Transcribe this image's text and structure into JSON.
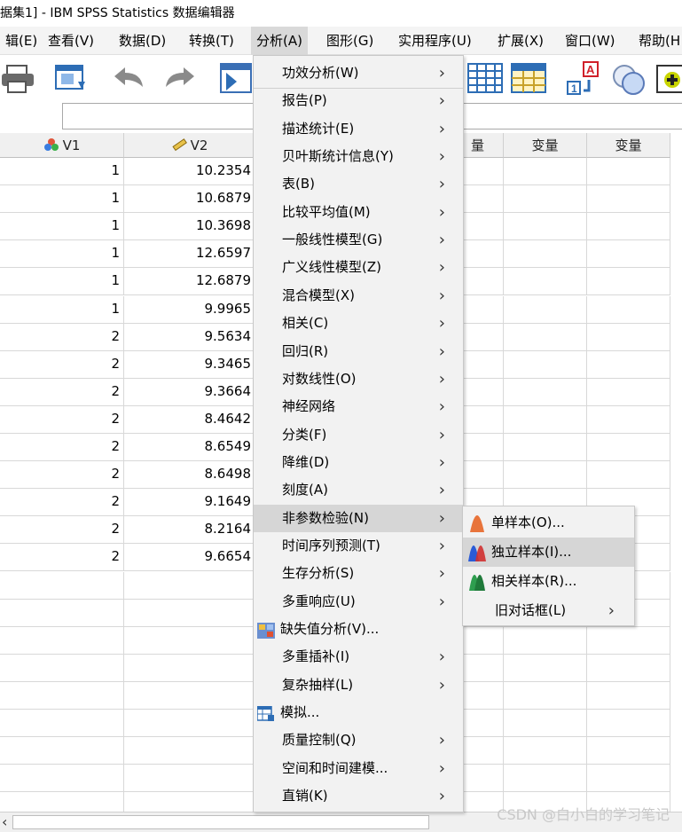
{
  "window": {
    "title": "据集1] - IBM SPSS Statistics 数据编辑器"
  },
  "menubar": [
    {
      "label": "辑(E)",
      "active": false
    },
    {
      "label": "查看(V)",
      "active": false
    },
    {
      "label": "数据(D)",
      "active": false
    },
    {
      "label": "转换(T)",
      "active": false
    },
    {
      "label": "分析(A)",
      "active": true
    },
    {
      "label": "图形(G)",
      "active": false
    },
    {
      "label": "实用程序(U)",
      "active": false
    },
    {
      "label": "扩展(X)",
      "active": false
    },
    {
      "label": "窗口(W)",
      "active": false
    },
    {
      "label": "帮助(H",
      "active": false
    }
  ],
  "toolbar": {
    "icons": [
      "print-icon",
      "recall-dialog-icon",
      "undo-icon",
      "redo-icon",
      "goto-case-icon",
      "goto-variable-icon",
      "variables-icon",
      "value-labels-icon",
      "use-sets-icon",
      "add-icon"
    ]
  },
  "grid": {
    "columns": [
      "V1",
      "V2",
      "变量",
      "变量",
      "变量"
    ],
    "rows": [
      [
        "1",
        "10.2354"
      ],
      [
        "1",
        "10.6879"
      ],
      [
        "1",
        "10.3698"
      ],
      [
        "1",
        "12.6597"
      ],
      [
        "1",
        "12.6879"
      ],
      [
        "1",
        "9.9965"
      ],
      [
        "2",
        "9.5634"
      ],
      [
        "2",
        "9.3465"
      ],
      [
        "2",
        "9.3664"
      ],
      [
        "2",
        "8.4642"
      ],
      [
        "2",
        "8.6549"
      ],
      [
        "2",
        "8.6498"
      ],
      [
        "2",
        "9.1649"
      ],
      [
        "2",
        "8.2164"
      ],
      [
        "2",
        "9.6654"
      ]
    ],
    "partial_col_header": "量"
  },
  "analyze_menu": {
    "items": [
      {
        "label": "功效分析(W)",
        "arrow": true
      },
      {
        "label": "报告(P)",
        "arrow": true
      },
      {
        "label": "描述统计(E)",
        "arrow": true
      },
      {
        "label": "贝叶斯统计信息(Y)",
        "arrow": true
      },
      {
        "label": "表(B)",
        "arrow": true
      },
      {
        "label": "比较平均值(M)",
        "arrow": true
      },
      {
        "label": "一般线性模型(G)",
        "arrow": true
      },
      {
        "label": "广义线性模型(Z)",
        "arrow": true
      },
      {
        "label": "混合模型(X)",
        "arrow": true
      },
      {
        "label": "相关(C)",
        "arrow": true
      },
      {
        "label": "回归(R)",
        "arrow": true
      },
      {
        "label": "对数线性(O)",
        "arrow": true
      },
      {
        "label": "神经网络",
        "arrow": true
      },
      {
        "label": "分类(F)",
        "arrow": true
      },
      {
        "label": "降维(D)",
        "arrow": true
      },
      {
        "label": "刻度(A)",
        "arrow": true
      },
      {
        "label": "非参数检验(N)",
        "arrow": true,
        "highlighted": true
      },
      {
        "label": "时间序列预测(T)",
        "arrow": true
      },
      {
        "label": "生存分析(S)",
        "arrow": true
      },
      {
        "label": "多重响应(U)",
        "arrow": true
      },
      {
        "label": "缺失值分析(V)...",
        "arrow": false,
        "icon": "missing-value-icon"
      },
      {
        "label": "多重插补(I)",
        "arrow": true
      },
      {
        "label": "复杂抽样(L)",
        "arrow": true
      },
      {
        "label": "模拟...",
        "arrow": false,
        "icon": "simulation-icon"
      },
      {
        "label": "质量控制(Q)",
        "arrow": true
      },
      {
        "label": "空间和时间建模...",
        "arrow": true
      },
      {
        "label": "直销(K)",
        "arrow": true
      }
    ]
  },
  "nonparam_submenu": {
    "items": [
      {
        "label": "单样本(O)...",
        "icon": "one-sample-icon",
        "color": "#e8743b"
      },
      {
        "label": "独立样本(I)...",
        "icon": "independent-samples-icon",
        "color": "#2a5bd7",
        "highlighted": true
      },
      {
        "label": "相关样本(R)...",
        "icon": "related-samples-icon",
        "color": "#2e9e4f"
      },
      {
        "label": "旧对话框(L)",
        "arrow": true
      }
    ]
  },
  "watermark": "CSDN @白小白的学习笔记",
  "colors": {
    "menu_bg": "#f2f2f2",
    "highlight": "#d6d6d6"
  }
}
